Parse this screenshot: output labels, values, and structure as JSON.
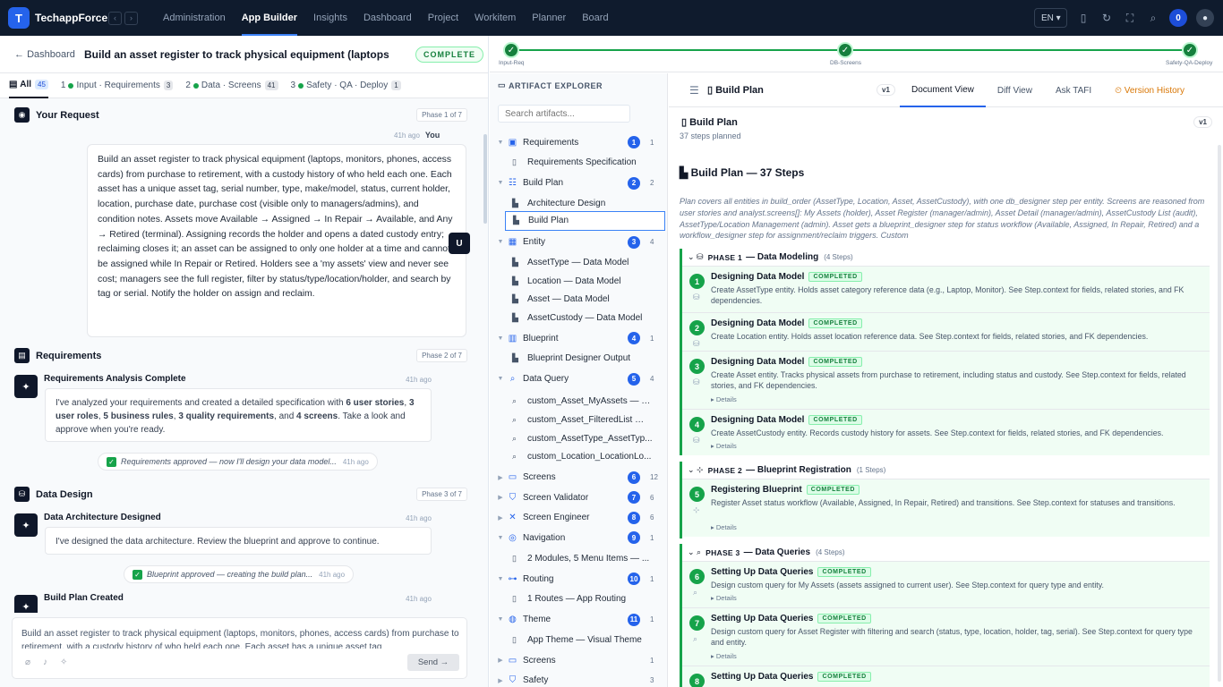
{
  "topbar": {
    "logo_letter": "T",
    "brand": "TechappForce",
    "nav": [
      "Administration",
      "App Builder",
      "Insights",
      "Dashboard",
      "Project",
      "Workitem",
      "Planner",
      "Board"
    ],
    "active_nav": "App Builder",
    "lang": "EN",
    "notif_count": "0"
  },
  "left": {
    "back": "Dashboard",
    "title": "Build an asset register to track physical equipment (laptops...",
    "status": "COMPLETE",
    "tabs": [
      {
        "num": "",
        "label": "All",
        "count": "45"
      },
      {
        "num": "1",
        "label": "Input · Requirements",
        "count": "3"
      },
      {
        "num": "2",
        "label": "Data · Screens",
        "count": "41"
      },
      {
        "num": "3",
        "label": "Safety · QA · Deploy",
        "count": "1"
      }
    ],
    "your_request": {
      "title": "Your Request",
      "phase": "Phase 1 of 7",
      "time": "41h ago",
      "who": "You",
      "avatar": "U",
      "text": "Build an asset register to track physical equipment (laptops, monitors, phones, access cards) from purchase to retirement, with a custody history of who held each one. Each asset has a unique asset tag, serial number, type, make/model, status, current holder, location, purchase date, purchase cost (visible only to managers/admins), and condition notes. Assets move Available → Assigned → In Repair → Available, and Any → Retired (terminal). Assigning records the holder and opens a dated custody entry; reclaiming closes it; an asset can be assigned to only one holder at a time and cannot be assigned while In Repair or Retired. Holders see a 'my assets' view and never see cost; managers see the full register, filter by status/type/location/holder, and search by tag or serial. Notify the holder on assign and reclaim."
    },
    "requirements": {
      "title": "Requirements",
      "phase": "Phase 2 of 7",
      "ai_title": "Requirements Analysis Complete",
      "time": "41h ago",
      "body_a": "I've analyzed your requirements and created a detailed specification with ",
      "n1": "6 user stories",
      "sep1": ", ",
      "n2": "3 user roles",
      "sep2": ", ",
      "n3": "5 business rules",
      "sep3": ", ",
      "n4": "3 quality requirements",
      "sep4": ", and ",
      "n5": "4 screens",
      "body_b": ". Take a look and approve when you're ready.",
      "pill": "Requirements approved — now I'll design your data model...",
      "pill_time": "41h ago"
    },
    "data_design": {
      "title": "Data Design",
      "phase": "Phase 3 of 7",
      "ai_title": "Data Architecture Designed",
      "time": "41h ago",
      "body": "I've designed the data architecture. Review the blueprint and approve to continue.",
      "pill": "Blueprint approved — creating the build plan...",
      "pill_time": "41h ago"
    },
    "build_plan": {
      "ai_title": "Build Plan Created",
      "time": "41h ago"
    },
    "composer": {
      "text": "Build an asset register to track physical equipment (laptops, monitors, phones, access cards) from purchase to retirement, with a custody history of who held each one. Each asset has a unique asset tag",
      "send": "Send →"
    }
  },
  "pipeline": {
    "nodes": [
      "Input-Req",
      "DB-Screens",
      "Safety-QA-Deploy"
    ]
  },
  "explorer": {
    "title": "ARTIFACT EXPLORER",
    "search_placeholder": "Search artifacts...",
    "groups": [
      {
        "label": "Requirements",
        "num": "1",
        "count": "1",
        "icon": "clipboard-icon",
        "open": true,
        "items": [
          "Requirements Specification"
        ]
      },
      {
        "label": "Build Plan",
        "num": "2",
        "count": "2",
        "icon": "list-icon",
        "open": true,
        "items": [
          "Architecture Design",
          "Build Plan"
        ]
      },
      {
        "label": "Entity",
        "num": "3",
        "count": "4",
        "icon": "grid-icon",
        "open": true,
        "items": [
          "AssetType — Data Model",
          "Location — Data Model",
          "Asset — Data Model",
          "AssetCustody — Data Model"
        ]
      },
      {
        "label": "Blueprint",
        "num": "4",
        "count": "1",
        "icon": "blueprint-icon",
        "open": true,
        "items": [
          "Blueprint Designer Output"
        ]
      },
      {
        "label": "Data Query",
        "num": "5",
        "count": "4",
        "icon": "search-icon",
        "open": true,
        "items": [
          "custom_Asset_MyAssets — D...",
          "custom_Asset_FilteredList — ...",
          "custom_AssetType_AssetTyp...",
          "custom_Location_LocationLo..."
        ]
      },
      {
        "label": "Screens",
        "num": "6",
        "count": "12",
        "icon": "screen-icon",
        "open": false,
        "items": []
      },
      {
        "label": "Screen Validator",
        "num": "7",
        "count": "6",
        "icon": "shield-icon",
        "open": false,
        "items": []
      },
      {
        "label": "Screen Engineer",
        "num": "8",
        "count": "6",
        "icon": "tools-icon",
        "open": false,
        "items": []
      },
      {
        "label": "Navigation",
        "num": "9",
        "count": "1",
        "icon": "compass-icon",
        "open": true,
        "items": [
          "2 Modules, 5 Menu Items — ..."
        ]
      },
      {
        "label": "Routing",
        "num": "10",
        "count": "1",
        "icon": "route-icon",
        "open": true,
        "items": [
          "1 Routes — App Routing"
        ]
      },
      {
        "label": "Theme",
        "num": "11",
        "count": "1",
        "icon": "palette-icon",
        "open": true,
        "items": [
          "App Theme — Visual Theme"
        ]
      },
      {
        "label": "Screens",
        "num": "",
        "count": "1",
        "icon": "screen-icon",
        "open": false,
        "items": []
      },
      {
        "label": "Safety",
        "num": "",
        "count": "3",
        "icon": "shield-icon",
        "open": false,
        "items": []
      }
    ],
    "selected": "Build Plan"
  },
  "doc": {
    "title": "Build Plan",
    "version": "v1",
    "tabs": [
      "Document View",
      "Diff View",
      "Ask TAFI",
      "Version History"
    ],
    "active_tab": "Document View",
    "card_title": "Build Plan",
    "card_sub": "37 steps planned",
    "card_ver": "v1",
    "heading": "Build Plan — 37 Steps",
    "description": "Plan covers all entities in build_order (AssetType, Location, Asset, AssetCustody), with one db_designer step per entity. Screens are reasoned from user stories and analyst.screens[]: My Assets (holder), Asset Register (manager/admin), Asset Detail (manager/admin), AssetCustody List (audit), AssetType/Location Management (admin). Asset gets a blueprint_designer step for status workflow (Available, Assigned, In Repair, Retired) and a workflow_designer step for assignment/reclaim triggers. Custom",
    "phases": [
      {
        "label": "PHASE 1",
        "name": "— Data Modeling",
        "count": "(4 Steps)",
        "steps": [
          {
            "n": "1",
            "title": "Designing Data Model",
            "badge": "COMPLETED",
            "desc": "Create AssetType entity. Holds asset category reference data (e.g., Laptop, Monitor). See Step.context for fields, related stories, and FK dependencies.",
            "details": ""
          },
          {
            "n": "2",
            "title": "Designing Data Model",
            "badge": "COMPLETED",
            "desc": "Create Location entity. Holds asset location reference data. See Step.context for fields, related stories, and FK dependencies.",
            "details": ""
          },
          {
            "n": "3",
            "title": "Designing Data Model",
            "badge": "COMPLETED",
            "desc": "Create Asset entity. Tracks physical assets from purchase to retirement, including status and custody. See Step.context for fields, related stories, and FK dependencies.",
            "details": "Details"
          },
          {
            "n": "4",
            "title": "Designing Data Model",
            "badge": "COMPLETED",
            "desc": "Create AssetCustody entity. Records custody history for assets. See Step.context for fields, related stories, and FK dependencies.",
            "details": "Details"
          }
        ]
      },
      {
        "label": "PHASE 2",
        "name": "— Blueprint Registration",
        "count": "(1 Steps)",
        "steps": [
          {
            "n": "5",
            "title": "Registering Blueprint",
            "badge": "COMPLETED",
            "desc": "Register Asset status workflow (Available, Assigned, In Repair, Retired) and transitions. See Step.context for statuses and transitions.",
            "details": "Details"
          }
        ]
      },
      {
        "label": "PHASE 3",
        "name": "— Data Queries",
        "count": "(4 Steps)",
        "steps": [
          {
            "n": "6",
            "title": "Setting Up Data Queries",
            "badge": "COMPLETED",
            "desc": "Design custom query for My Assets (assets assigned to current user). See Step.context for query type and entity.",
            "details": "Details"
          },
          {
            "n": "7",
            "title": "Setting Up Data Queries",
            "badge": "COMPLETED",
            "desc": "Design custom query for Asset Register with filtering and search (status, type, location, holder, tag, serial). See Step.context for query type and entity.",
            "details": "Details"
          },
          {
            "n": "8",
            "title": "Setting Up Data Queries",
            "badge": "COMPLETED",
            "desc": "",
            "details": ""
          }
        ]
      }
    ]
  }
}
